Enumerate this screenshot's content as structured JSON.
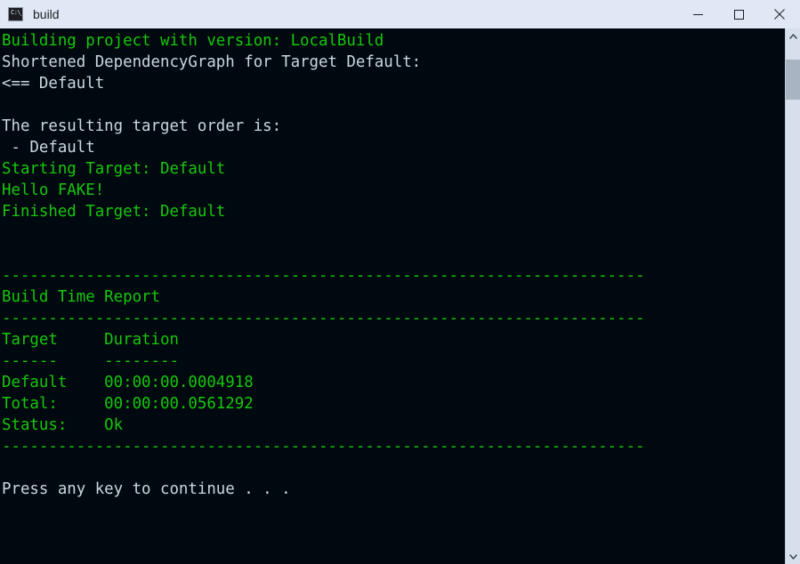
{
  "window": {
    "title": "build",
    "icon": "console-app-icon",
    "icon_glyph": "C:\\_",
    "colors": {
      "titlebar_bg": "#dfe8f4",
      "console_bg": "#00090f",
      "green_text": "#16c60c",
      "white_text": "#ccd6e1",
      "scrollbar_track": "#d6dfeb",
      "scrollbar_thumb": "#a9b4c3"
    },
    "controls": {
      "minimize_label": "Minimize",
      "maximize_label": "Maximize",
      "close_label": "Close"
    }
  },
  "scrollbar": {
    "up_arrow": "scroll-up-arrow",
    "down_arrow": "scroll-down-arrow",
    "thumb": "scrollbar-thumb"
  },
  "console": {
    "lines": [
      {
        "text": "Building project with version: LocalBuild",
        "color": "green"
      },
      {
        "text": "Shortened DependencyGraph for Target Default:",
        "color": "white"
      },
      {
        "text": "<== Default",
        "color": "white"
      },
      {
        "text": "",
        "color": "white"
      },
      {
        "text": "The resulting target order is:",
        "color": "white"
      },
      {
        "text": " - Default",
        "color": "white"
      },
      {
        "text": "Starting Target: Default",
        "color": "green"
      },
      {
        "text": "Hello FAKE!",
        "color": "green"
      },
      {
        "text": "Finished Target: Default",
        "color": "green"
      },
      {
        "text": "",
        "color": "green"
      },
      {
        "text": "",
        "color": "green"
      },
      {
        "text": "---------------------------------------------------------------------",
        "color": "green"
      },
      {
        "text": "Build Time Report",
        "color": "green"
      },
      {
        "text": "---------------------------------------------------------------------",
        "color": "green"
      },
      {
        "text": "Target     Duration",
        "color": "green"
      },
      {
        "text": "------     --------",
        "color": "green"
      },
      {
        "text": "Default    00:00:00.0004918",
        "color": "green"
      },
      {
        "text": "Total:     00:00:00.0561292",
        "color": "green"
      },
      {
        "text": "Status:    Ok",
        "color": "green"
      },
      {
        "text": "---------------------------------------------------------------------",
        "color": "green"
      },
      {
        "text": "",
        "color": "green"
      },
      {
        "text": "Press any key to continue . . .",
        "color": "white"
      }
    ],
    "report": {
      "title": "Build Time Report",
      "columns": [
        "Target",
        "Duration"
      ],
      "rows": [
        {
          "target": "Default",
          "duration": "00:00:00.0004918"
        },
        {
          "target": "Total:",
          "duration": "00:00:00.0561292"
        },
        {
          "target": "Status:",
          "duration": "Ok"
        }
      ]
    },
    "prompt": "Press any key to continue . . ."
  }
}
